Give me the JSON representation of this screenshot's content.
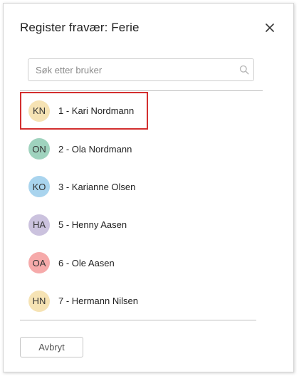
{
  "dialog": {
    "title": "Register fravær: Ferie"
  },
  "search": {
    "placeholder": "Søk etter bruker",
    "value": ""
  },
  "users": [
    {
      "initials": "KN",
      "label": "1 - Kari Nordmann",
      "avatar_color": "#f6e3b4",
      "highlighted": true
    },
    {
      "initials": "ON",
      "label": "2 - Ola Nordmann",
      "avatar_color": "#9fd3be"
    },
    {
      "initials": "KO",
      "label": "3 - Karianne Olsen",
      "avatar_color": "#a9d4ee"
    },
    {
      "initials": "HA",
      "label": "5 - Henny Aasen",
      "avatar_color": "#cbc2de"
    },
    {
      "initials": "OA",
      "label": "6 - Ole Aasen",
      "avatar_color": "#f6aaaa"
    },
    {
      "initials": "HN",
      "label": "7 - Hermann Nilsen",
      "avatar_color": "#f6e3b4"
    }
  ],
  "footer": {
    "cancel_label": "Avbryt"
  },
  "colors": {
    "highlight_border": "#d32f2f",
    "divider": "#bdbdbd"
  },
  "icons": {
    "close": "close-icon",
    "search": "search-icon"
  }
}
